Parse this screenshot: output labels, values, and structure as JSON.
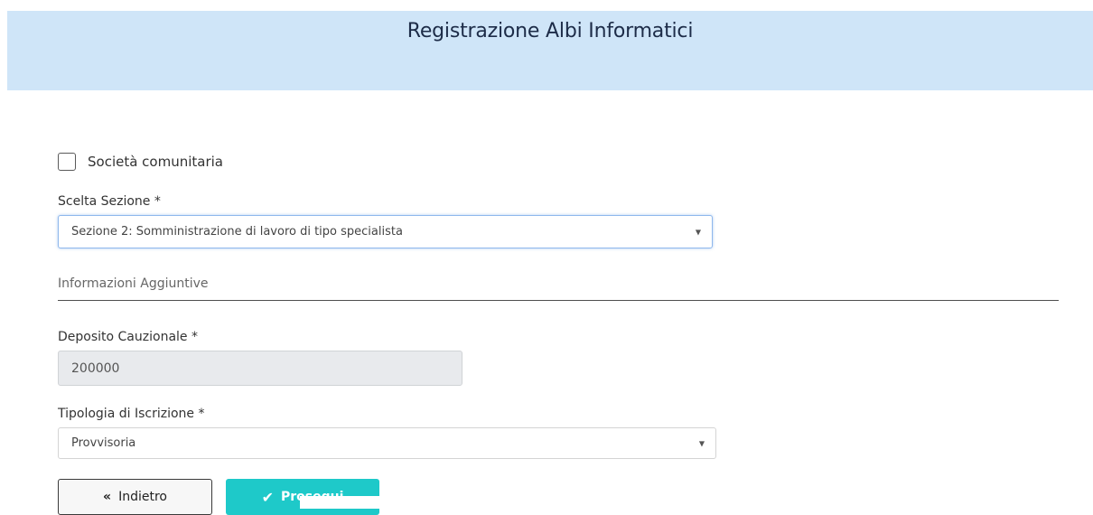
{
  "header": {
    "title": "Registrazione Albi Informatici"
  },
  "form": {
    "community_checkbox": {
      "label": "Società comunitaria",
      "checked": false
    },
    "section_select": {
      "label": "Scelta Sezione *",
      "value": "Sezione 2: Somministrazione di lavoro di tipo specialista"
    },
    "additional_info": {
      "title": "Informazioni Aggiuntive"
    },
    "deposit": {
      "label": "Deposito Cauzionale *",
      "value": "200000"
    },
    "registration_type": {
      "label": "Tipologia di Iscrizione *",
      "value": "Provvisoria"
    }
  },
  "buttons": {
    "back": {
      "label": "Indietro",
      "icon": "double-chevron-left-icon"
    },
    "next": {
      "label": "Prosegui",
      "icon": "check-icon"
    }
  },
  "colors": {
    "header_bg": "#cfe5f8",
    "primary": "#1ec9c9"
  }
}
